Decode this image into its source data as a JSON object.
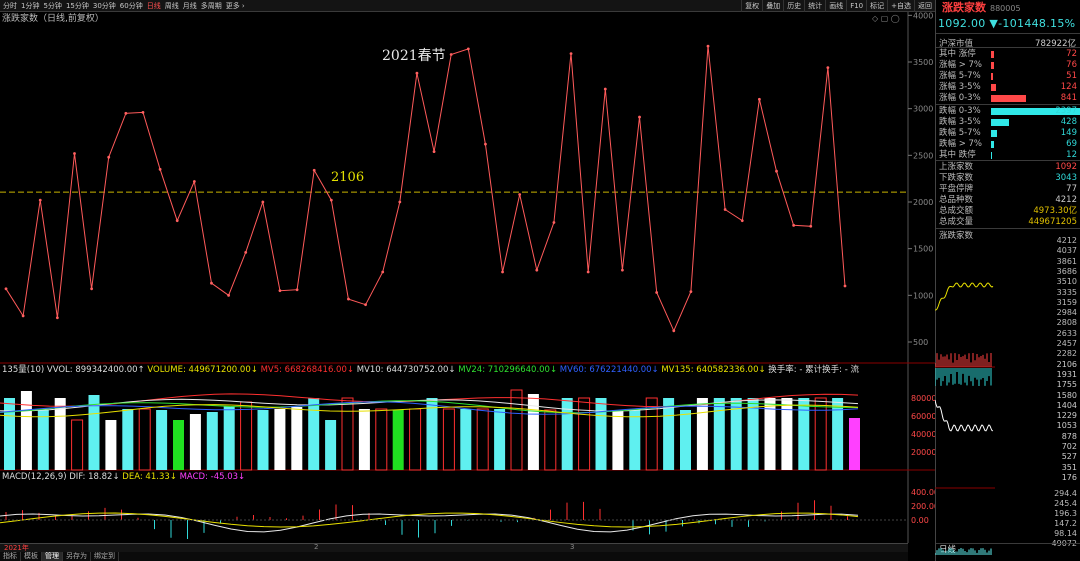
{
  "toolbar": {
    "tabs": [
      "分时",
      "1分钟",
      "5分钟",
      "15分钟",
      "30分钟",
      "60分钟",
      "日线",
      "周线",
      "月线",
      "多周期",
      "更多 ›"
    ],
    "active_tab": "日线",
    "right_buttons": [
      "复权",
      "叠加",
      "历史",
      "统计",
      "画线",
      "F10",
      "标记",
      "+自选",
      "返回"
    ]
  },
  "indicator_title": "涨跌家数（日线,前复权）",
  "annotation_holiday": "2021春节",
  "annotation_level": "2106",
  "chart_data": [
    {
      "type": "line",
      "name": "main",
      "values": [
        1070,
        780,
        2020,
        760,
        2520,
        1070,
        2480,
        2950,
        2960,
        2350,
        1800,
        2220,
        1130,
        1000,
        1460,
        2000,
        1050,
        1060,
        2340,
        2020,
        960,
        900,
        1250,
        2000,
        3380,
        2540,
        3580,
        3640,
        2620,
        1250,
        2080,
        1270,
        1780,
        3590,
        1250,
        3210,
        1270,
        2910,
        1030,
        620,
        1040,
        3670,
        1920,
        1800,
        3100,
        2330,
        1750,
        1740,
        3440,
        1100
      ],
      "ylim": [
        500,
        4100
      ],
      "yticks": [
        500,
        1000,
        1500,
        2000,
        2500,
        3000,
        3500,
        4000
      ],
      "reference_line": 2106
    },
    {
      "type": "bar",
      "name": "volume",
      "legend": {
        "vvol": "135量(10) VVOL: 899342400.00↑",
        "volume": "VOLUME: 449671200.00↓",
        "mv5": "MV5: 668268416.00↓",
        "mv10": "MV10: 644730752.00↓",
        "mv24": "MV24: 710296640.00↓",
        "mv60": "MV60: 676221440.00↓",
        "mv135": "MV135: 640582336.00↓",
        "turnover": "换手率: - 累计换手: - 流"
      },
      "values": [
        72,
        79,
        60,
        72,
        0,
        75,
        0,
        61,
        61,
        60,
        50,
        56,
        58,
        64,
        68,
        60,
        61,
        63,
        72,
        0,
        72,
        61,
        61,
        60,
        61,
        72,
        61,
        61,
        61,
        61,
        80,
        76,
        60,
        72,
        72,
        72,
        60,
        60,
        72,
        72,
        60,
        72,
        72,
        72,
        72,
        72,
        72,
        72,
        72,
        72,
        52
      ],
      "ylim": [
        0,
        90
      ],
      "yticks": [
        20000,
        40000,
        60000,
        80000
      ]
    },
    {
      "type": "line",
      "name": "macd",
      "legend": {
        "title": "MACD(12,26,9)",
        "dif": "DIF: 18.82↓",
        "dea": "DEA: 41.33↓",
        "macd": "MACD: -45.03↓"
      },
      "yticks": [
        400,
        200,
        0
      ]
    }
  ],
  "xaxis_labels": [
    "2021年",
    "2",
    "3"
  ],
  "bottom_tabs": [
    "指标",
    "模板",
    "管理",
    "另存为",
    "绑定到"
  ],
  "right_panel": {
    "name": "涨跌家数",
    "code": "880005",
    "price": "1092.00",
    "change": "▼-1014",
    "pct": "48.15%",
    "market_cap_label": "沪深市值",
    "market_cap": "782922亿",
    "up_rows": [
      {
        "label": "其中 涨停",
        "value": "72"
      },
      {
        "label": "涨幅 > 7%",
        "value": "76"
      },
      {
        "label": "涨幅 5-7%",
        "value": "51"
      },
      {
        "label": "涨幅 3-5%",
        "value": "124"
      },
      {
        "label": "涨幅 0-3%",
        "value": "841"
      }
    ],
    "down_rows": [
      {
        "label": "跌幅 0-3%",
        "value": "2397"
      },
      {
        "label": "跌幅 3-5%",
        "value": "428"
      },
      {
        "label": "跌幅 5-7%",
        "value": "149"
      },
      {
        "label": "跌幅 > 7%",
        "value": "69"
      },
      {
        "label": "其中 跌停",
        "value": "12"
      }
    ],
    "stats": [
      {
        "label": "上涨家数",
        "value": "1092",
        "color": "#ff4848"
      },
      {
        "label": "下跌家数",
        "value": "3043",
        "color": "#30d8d8"
      },
      {
        "label": "平盘停牌",
        "value": "77",
        "color": "#cccccc"
      },
      {
        "label": "总品种数",
        "value": "4212",
        "color": "#cccccc"
      },
      {
        "label": "总成交额",
        "value": "4973.30亿",
        "color": "#e0c000"
      },
      {
        "label": "总成交量",
        "value": "449671205",
        "color": "#e0c000"
      }
    ],
    "mini_title": "涨跌家数",
    "mini_axis": [
      "4212",
      "4037",
      "3861",
      "3686",
      "3510",
      "3335",
      "3159",
      "2984",
      "2808",
      "2633",
      "2457",
      "2282",
      "2106",
      "1931",
      "1755",
      "1580",
      "1404",
      "1229",
      "1053",
      "878",
      "702",
      "527",
      "351",
      "176"
    ],
    "mini_axis2": [
      "294.4",
      "245.4",
      "196.3",
      "147.2",
      "98.14",
      "49072"
    ],
    "mini_footer": "日线"
  }
}
